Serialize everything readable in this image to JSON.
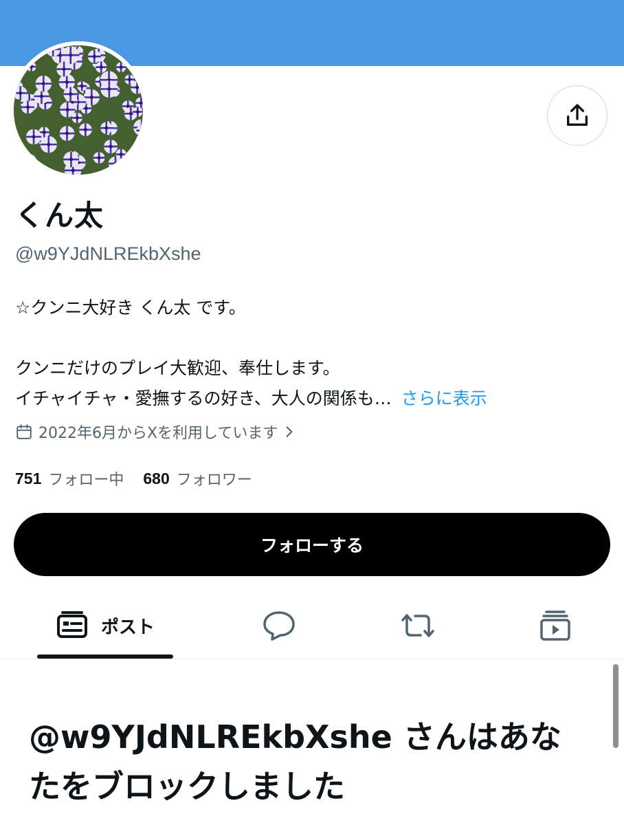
{
  "profile": {
    "display_name": "くん太",
    "handle": "@w9YJdNLREkbXshe",
    "bio": {
      "line1": "☆クンニ大好き くん太 です。",
      "line2": "クンニだけのプレイ大歓迎、奉仕します。",
      "line3": "イチャイチャ・愛撫するの好き、大人の関係も…",
      "more_link": "さらに表示"
    },
    "joined": "2022年6月からXを利用しています",
    "following_count": "751",
    "following_label": "フォロー中",
    "followers_count": "680",
    "followers_label": "フォロワー"
  },
  "actions": {
    "follow_label": "フォローする",
    "share_icon": "share-upload-icon"
  },
  "tabs": [
    {
      "label": "ポスト",
      "icon": "posts-icon",
      "selected": true
    },
    {
      "label": "",
      "icon": "reply-bubble-icon",
      "selected": false
    },
    {
      "label": "",
      "icon": "repost-icon",
      "selected": false
    },
    {
      "label": "",
      "icon": "media-icon",
      "selected": false
    }
  ],
  "blocked_message": "@w9YJdNLREkbXshe さんはあなたをブロックしました",
  "colors": {
    "banner": "#4a98e1",
    "link": "#1d9bf0",
    "secondary_text": "#536471",
    "follow_button": "#000000"
  }
}
